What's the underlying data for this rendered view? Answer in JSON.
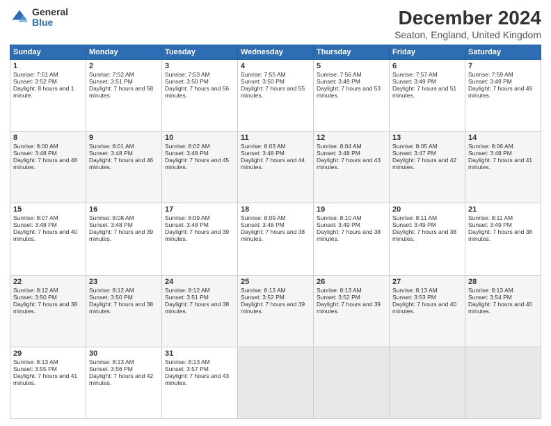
{
  "logo": {
    "general": "General",
    "blue": "Blue"
  },
  "title": "December 2024",
  "subtitle": "Seaton, England, United Kingdom",
  "days": [
    "Sunday",
    "Monday",
    "Tuesday",
    "Wednesday",
    "Thursday",
    "Friday",
    "Saturday"
  ],
  "weeks": [
    [
      {
        "num": "1",
        "sunrise": "Sunrise: 7:51 AM",
        "sunset": "Sunset: 3:52 PM",
        "daylight": "Daylight: 8 hours and 1 minute."
      },
      {
        "num": "2",
        "sunrise": "Sunrise: 7:52 AM",
        "sunset": "Sunset: 3:51 PM",
        "daylight": "Daylight: 7 hours and 58 minutes."
      },
      {
        "num": "3",
        "sunrise": "Sunrise: 7:53 AM",
        "sunset": "Sunset: 3:50 PM",
        "daylight": "Daylight: 7 hours and 56 minutes."
      },
      {
        "num": "4",
        "sunrise": "Sunrise: 7:55 AM",
        "sunset": "Sunset: 3:50 PM",
        "daylight": "Daylight: 7 hours and 55 minutes."
      },
      {
        "num": "5",
        "sunrise": "Sunrise: 7:56 AM",
        "sunset": "Sunset: 3:49 PM",
        "daylight": "Daylight: 7 hours and 53 minutes."
      },
      {
        "num": "6",
        "sunrise": "Sunrise: 7:57 AM",
        "sunset": "Sunset: 3:49 PM",
        "daylight": "Daylight: 7 hours and 51 minutes."
      },
      {
        "num": "7",
        "sunrise": "Sunrise: 7:59 AM",
        "sunset": "Sunset: 3:49 PM",
        "daylight": "Daylight: 7 hours and 49 minutes."
      }
    ],
    [
      {
        "num": "8",
        "sunrise": "Sunrise: 8:00 AM",
        "sunset": "Sunset: 3:48 PM",
        "daylight": "Daylight: 7 hours and 48 minutes."
      },
      {
        "num": "9",
        "sunrise": "Sunrise: 8:01 AM",
        "sunset": "Sunset: 3:48 PM",
        "daylight": "Daylight: 7 hours and 46 minutes."
      },
      {
        "num": "10",
        "sunrise": "Sunrise: 8:02 AM",
        "sunset": "Sunset: 3:48 PM",
        "daylight": "Daylight: 7 hours and 45 minutes."
      },
      {
        "num": "11",
        "sunrise": "Sunrise: 8:03 AM",
        "sunset": "Sunset: 3:48 PM",
        "daylight": "Daylight: 7 hours and 44 minutes."
      },
      {
        "num": "12",
        "sunrise": "Sunrise: 8:04 AM",
        "sunset": "Sunset: 3:48 PM",
        "daylight": "Daylight: 7 hours and 43 minutes."
      },
      {
        "num": "13",
        "sunrise": "Sunrise: 8:05 AM",
        "sunset": "Sunset: 3:47 PM",
        "daylight": "Daylight: 7 hours and 42 minutes."
      },
      {
        "num": "14",
        "sunrise": "Sunrise: 8:06 AM",
        "sunset": "Sunset: 3:48 PM",
        "daylight": "Daylight: 7 hours and 41 minutes."
      }
    ],
    [
      {
        "num": "15",
        "sunrise": "Sunrise: 8:07 AM",
        "sunset": "Sunset: 3:48 PM",
        "daylight": "Daylight: 7 hours and 40 minutes."
      },
      {
        "num": "16",
        "sunrise": "Sunrise: 8:08 AM",
        "sunset": "Sunset: 3:48 PM",
        "daylight": "Daylight: 7 hours and 39 minutes."
      },
      {
        "num": "17",
        "sunrise": "Sunrise: 8:09 AM",
        "sunset": "Sunset: 3:48 PM",
        "daylight": "Daylight: 7 hours and 39 minutes."
      },
      {
        "num": "18",
        "sunrise": "Sunrise: 8:09 AM",
        "sunset": "Sunset: 3:48 PM",
        "daylight": "Daylight: 7 hours and 38 minutes."
      },
      {
        "num": "19",
        "sunrise": "Sunrise: 8:10 AM",
        "sunset": "Sunset: 3:49 PM",
        "daylight": "Daylight: 7 hours and 38 minutes."
      },
      {
        "num": "20",
        "sunrise": "Sunrise: 8:11 AM",
        "sunset": "Sunset: 3:49 PM",
        "daylight": "Daylight: 7 hours and 38 minutes."
      },
      {
        "num": "21",
        "sunrise": "Sunrise: 8:11 AM",
        "sunset": "Sunset: 3:49 PM",
        "daylight": "Daylight: 7 hours and 38 minutes."
      }
    ],
    [
      {
        "num": "22",
        "sunrise": "Sunrise: 8:12 AM",
        "sunset": "Sunset: 3:50 PM",
        "daylight": "Daylight: 7 hours and 38 minutes."
      },
      {
        "num": "23",
        "sunrise": "Sunrise: 8:12 AM",
        "sunset": "Sunset: 3:50 PM",
        "daylight": "Daylight: 7 hours and 38 minutes."
      },
      {
        "num": "24",
        "sunrise": "Sunrise: 8:12 AM",
        "sunset": "Sunset: 3:51 PM",
        "daylight": "Daylight: 7 hours and 38 minutes."
      },
      {
        "num": "25",
        "sunrise": "Sunrise: 8:13 AM",
        "sunset": "Sunset: 3:52 PM",
        "daylight": "Daylight: 7 hours and 39 minutes."
      },
      {
        "num": "26",
        "sunrise": "Sunrise: 8:13 AM",
        "sunset": "Sunset: 3:52 PM",
        "daylight": "Daylight: 7 hours and 39 minutes."
      },
      {
        "num": "27",
        "sunrise": "Sunrise: 8:13 AM",
        "sunset": "Sunset: 3:53 PM",
        "daylight": "Daylight: 7 hours and 40 minutes."
      },
      {
        "num": "28",
        "sunrise": "Sunrise: 8:13 AM",
        "sunset": "Sunset: 3:54 PM",
        "daylight": "Daylight: 7 hours and 40 minutes."
      }
    ],
    [
      {
        "num": "29",
        "sunrise": "Sunrise: 8:13 AM",
        "sunset": "Sunset: 3:55 PM",
        "daylight": "Daylight: 7 hours and 41 minutes."
      },
      {
        "num": "30",
        "sunrise": "Sunrise: 8:13 AM",
        "sunset": "Sunset: 3:56 PM",
        "daylight": "Daylight: 7 hours and 42 minutes."
      },
      {
        "num": "31",
        "sunrise": "Sunrise: 8:13 AM",
        "sunset": "Sunset: 3:57 PM",
        "daylight": "Daylight: 7 hours and 43 minutes."
      },
      null,
      null,
      null,
      null
    ]
  ]
}
